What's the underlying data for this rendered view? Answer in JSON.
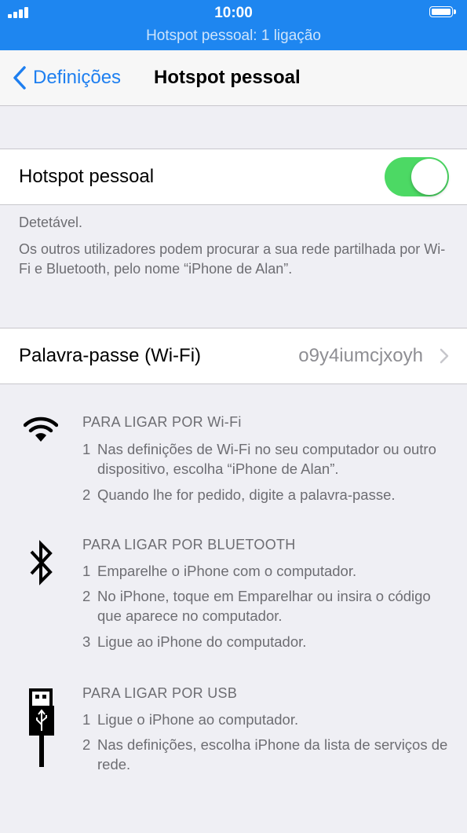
{
  "status_bar": {
    "time": "10:00",
    "hotspot_status": "Hotspot pessoal: 1 ligação",
    "signal_icon": "signal-bars-icon",
    "battery_icon": "battery-full-icon"
  },
  "nav": {
    "back_label": "Definições",
    "title": "Hotspot pessoal"
  },
  "hotspot_toggle": {
    "label": "Hotspot pessoal",
    "on": true,
    "accent": "#4cd964"
  },
  "footer": {
    "discoverable": "Detetável.",
    "description": "Os outros utilizadores podem procurar a sua rede partilhada por Wi-Fi e Bluetooth, pelo nome “iPhone de Alan”."
  },
  "password": {
    "label": "Palavra-passe (Wi-Fi)",
    "value": "o9y4iumcjxoyh"
  },
  "instructions": [
    {
      "icon": "wifi-icon",
      "title": "PARA LIGAR POR Wi-Fi",
      "steps": [
        {
          "num": "1",
          "text": "Nas definições de Wi-Fi no seu computador ou outro dispositivo, escolha “iPhone de Alan”."
        },
        {
          "num": "2",
          "text": "Quando lhe for pedido, digite a palavra-passe."
        }
      ]
    },
    {
      "icon": "bluetooth-icon",
      "title": "PARA LIGAR POR BLUETOOTH",
      "steps": [
        {
          "num": "1",
          "text": "Emparelhe o iPhone com o computador."
        },
        {
          "num": "2",
          "text": "No iPhone, toque em Emparelhar ou insira o código que aparece no computador."
        },
        {
          "num": "3",
          "text": "Ligue ao iPhone do computador."
        }
      ]
    },
    {
      "icon": "usb-cable-icon",
      "title": "PARA LIGAR POR USB",
      "steps": [
        {
          "num": "1",
          "text": "Ligue o iPhone ao computador."
        },
        {
          "num": "2",
          "text": "Nas definições, escolha iPhone da lista de serviços de rede."
        }
      ]
    }
  ],
  "colors": {
    "status_bar": "#1e86f0",
    "link": "#1e7ff0",
    "background": "#efeff4"
  }
}
